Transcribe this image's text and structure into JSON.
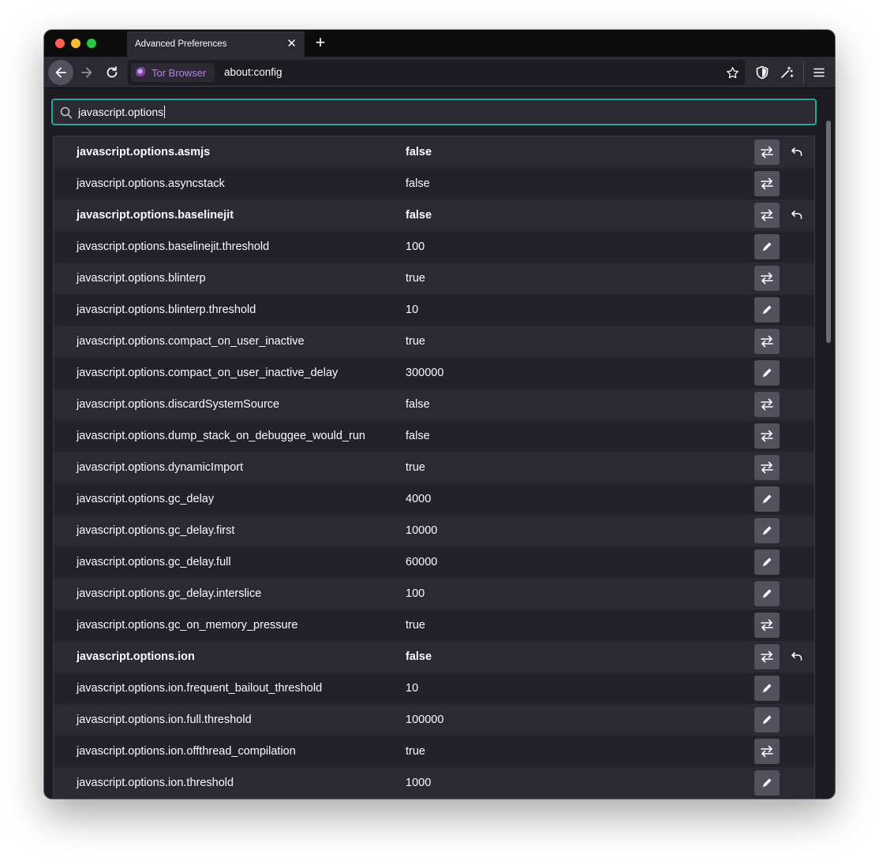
{
  "tab": {
    "title": "Advanced Preferences",
    "close_glyph": "✕",
    "new_tab_glyph": "+"
  },
  "urlbar": {
    "identity_label": "Tor Browser",
    "url": "about:config"
  },
  "search": {
    "value": "javascript.options"
  },
  "prefs": [
    {
      "name": "javascript.options.asmjs",
      "value": "false",
      "type": "toggle",
      "modified": true
    },
    {
      "name": "javascript.options.asyncstack",
      "value": "false",
      "type": "toggle",
      "modified": false
    },
    {
      "name": "javascript.options.baselinejit",
      "value": "false",
      "type": "toggle",
      "modified": true
    },
    {
      "name": "javascript.options.baselinejit.threshold",
      "value": "100",
      "type": "edit",
      "modified": false
    },
    {
      "name": "javascript.options.blinterp",
      "value": "true",
      "type": "toggle",
      "modified": false
    },
    {
      "name": "javascript.options.blinterp.threshold",
      "value": "10",
      "type": "edit",
      "modified": false
    },
    {
      "name": "javascript.options.compact_on_user_inactive",
      "value": "true",
      "type": "toggle",
      "modified": false
    },
    {
      "name": "javascript.options.compact_on_user_inactive_delay",
      "value": "300000",
      "type": "edit",
      "modified": false
    },
    {
      "name": "javascript.options.discardSystemSource",
      "value": "false",
      "type": "toggle",
      "modified": false
    },
    {
      "name": "javascript.options.dump_stack_on_debuggee_would_run",
      "value": "false",
      "type": "toggle",
      "modified": false
    },
    {
      "name": "javascript.options.dynamicImport",
      "value": "true",
      "type": "toggle",
      "modified": false
    },
    {
      "name": "javascript.options.gc_delay",
      "value": "4000",
      "type": "edit",
      "modified": false
    },
    {
      "name": "javascript.options.gc_delay.first",
      "value": "10000",
      "type": "edit",
      "modified": false
    },
    {
      "name": "javascript.options.gc_delay.full",
      "value": "60000",
      "type": "edit",
      "modified": false
    },
    {
      "name": "javascript.options.gc_delay.interslice",
      "value": "100",
      "type": "edit",
      "modified": false
    },
    {
      "name": "javascript.options.gc_on_memory_pressure",
      "value": "true",
      "type": "toggle",
      "modified": false
    },
    {
      "name": "javascript.options.ion",
      "value": "false",
      "type": "toggle",
      "modified": true
    },
    {
      "name": "javascript.options.ion.frequent_bailout_threshold",
      "value": "10",
      "type": "edit",
      "modified": false
    },
    {
      "name": "javascript.options.ion.full.threshold",
      "value": "100000",
      "type": "edit",
      "modified": false
    },
    {
      "name": "javascript.options.ion.offthread_compilation",
      "value": "true",
      "type": "toggle",
      "modified": false
    },
    {
      "name": "javascript.options.ion.threshold",
      "value": "1000",
      "type": "edit",
      "modified": false
    }
  ],
  "colors": {
    "accent_focus": "#26a69a",
    "tor_purple": "#b481e0"
  },
  "icons": {
    "back": "back-arrow-icon",
    "forward": "forward-arrow-icon",
    "reload": "reload-icon",
    "star": "star-icon",
    "shield": "shield-icon",
    "wand": "magic-wand-icon",
    "menu": "hamburger-menu-icon",
    "toggle": "toggle-arrows-icon",
    "edit": "pencil-icon",
    "reset": "reset-arrow-icon",
    "search": "search-icon"
  }
}
